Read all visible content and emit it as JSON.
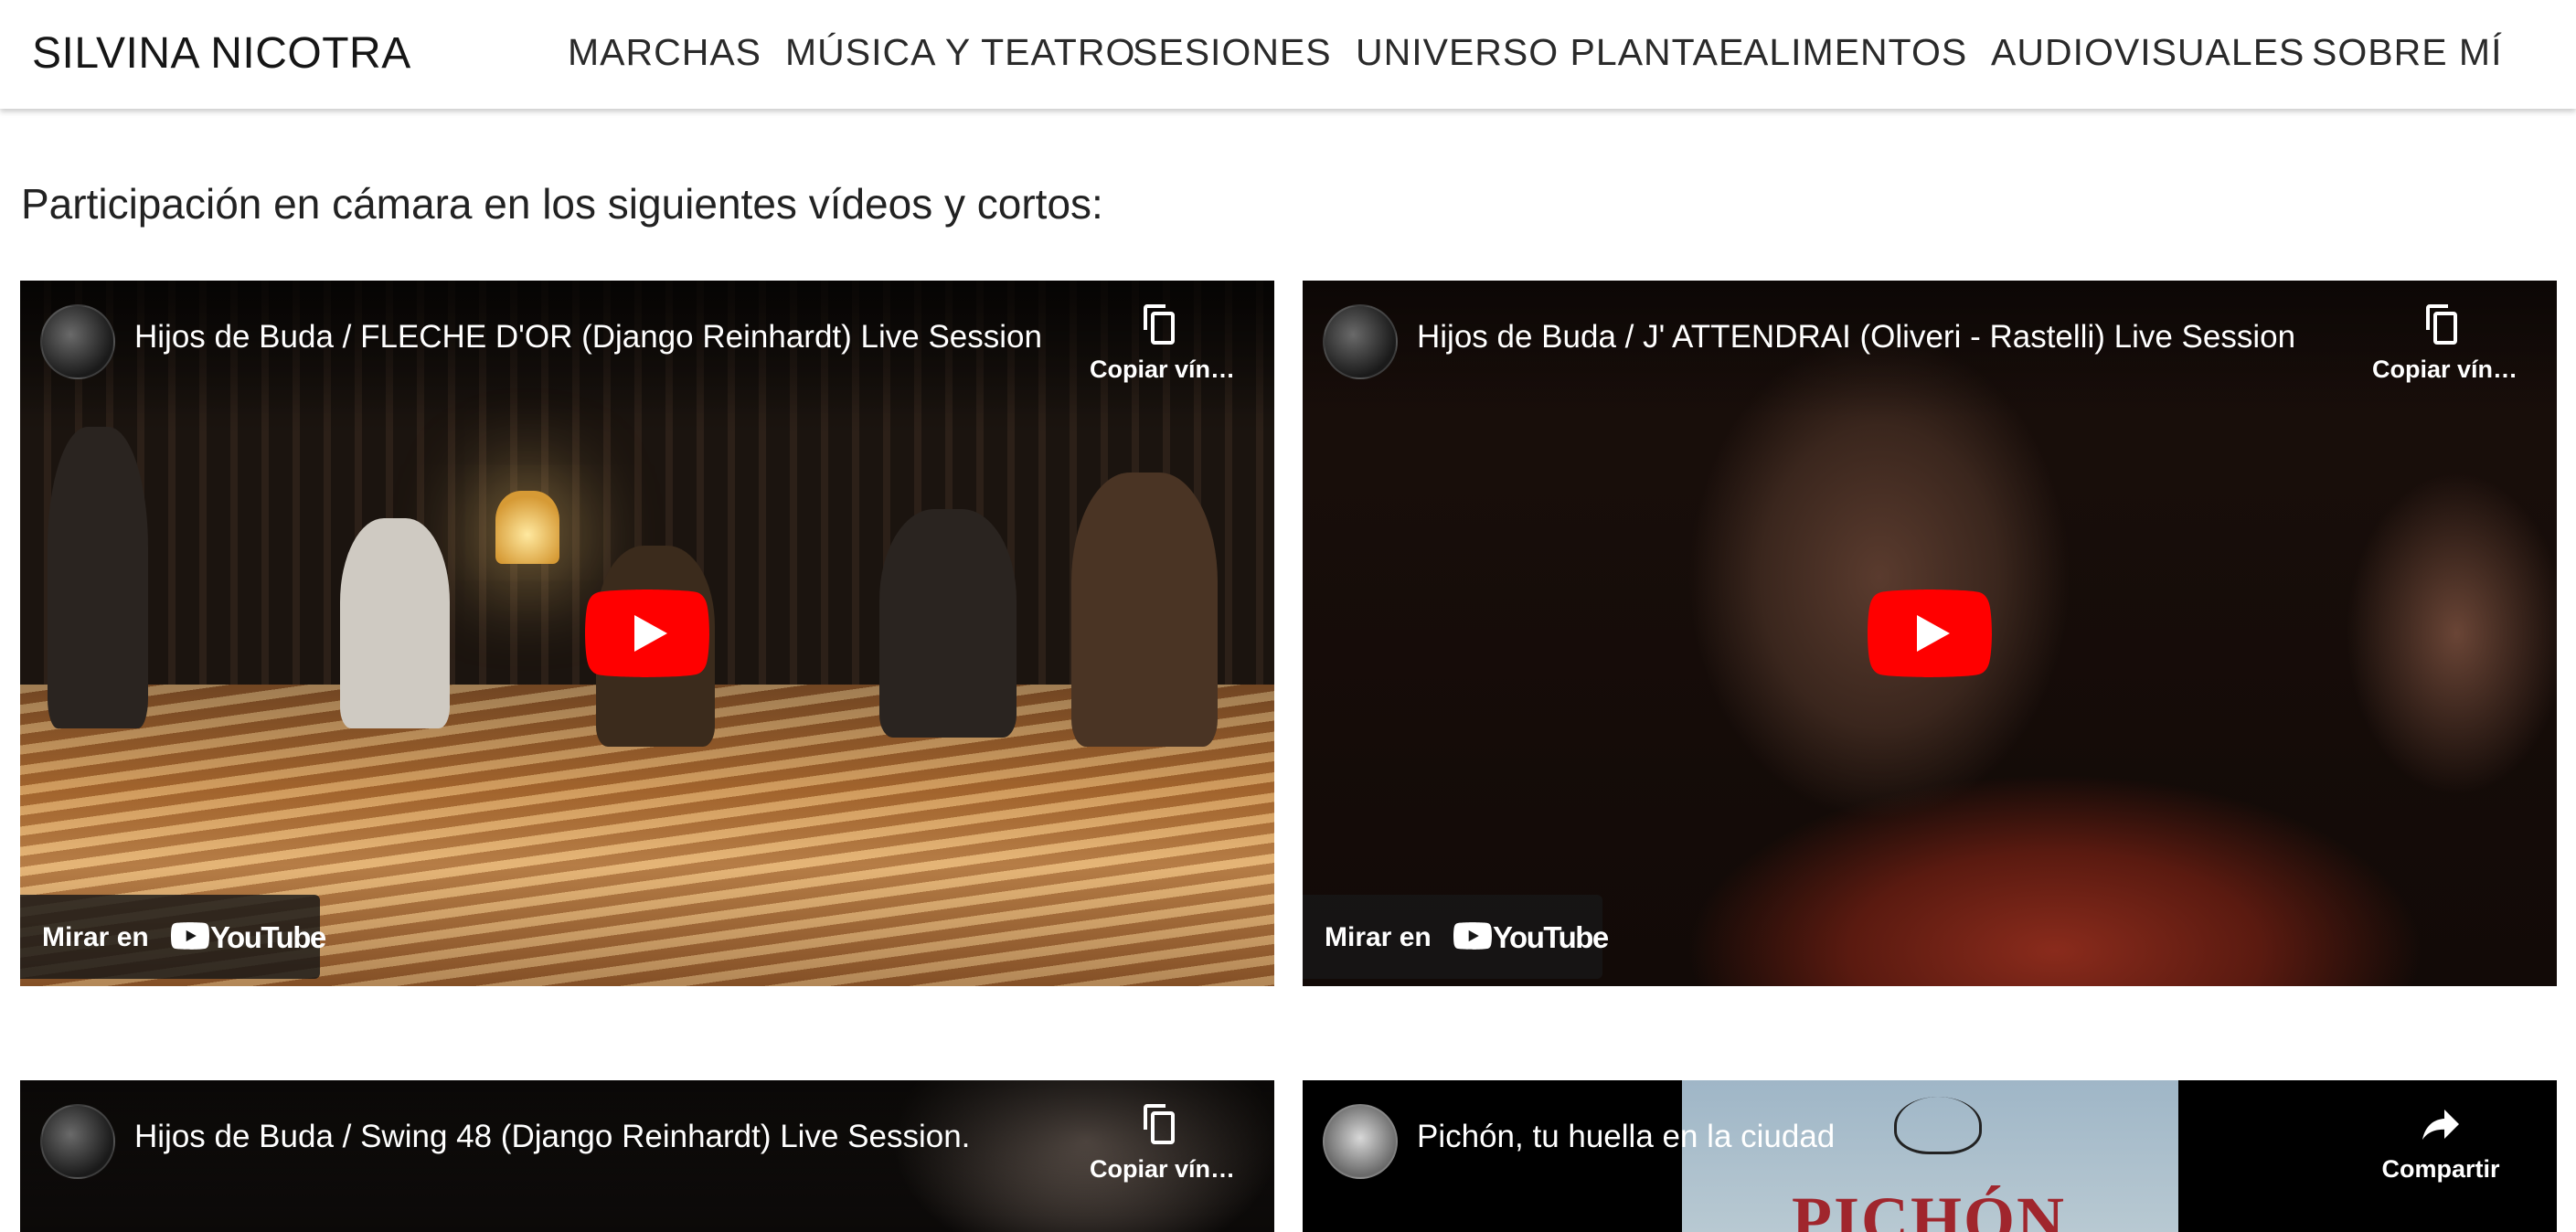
{
  "header": {
    "brand": "SILVINA NICOTRA",
    "nav": [
      "MARCHAS",
      "MÚSICA Y TEATRO",
      "SESIONES",
      "UNIVERSO PLANTAE",
      "ALIMENTOS",
      "AUDIOVISUALES",
      "SOBRE MÍ"
    ]
  },
  "intro": "Participación en cámara en los siguientes vídeos y cortos:",
  "videos": [
    {
      "title": "Hijos de Buda / FLECHE D'OR (Django Reinhardt) Live Session",
      "action_label": "Copiar vín…",
      "action_icon": "copy-icon",
      "watch_label": "Mirar en",
      "watch_brand": "YouTube"
    },
    {
      "title": "Hijos de Buda / J' ATTENDRAI (Oliveri - Rastelli) Live Session",
      "action_label": "Copiar vín…",
      "action_icon": "copy-icon",
      "watch_label": "Mirar en",
      "watch_brand": "YouTube"
    },
    {
      "title": "Hijos de Buda / Swing 48 (Django Reinhardt) Live Session.",
      "action_label": "Copiar vín…",
      "action_icon": "copy-icon"
    },
    {
      "title": "Pichón, tu huella en la ciudad",
      "action_label": "Compartir",
      "action_icon": "share-icon",
      "poster_text": "PICHÓN"
    }
  ],
  "colors": {
    "play_red": "#ff0000",
    "header_bg": "#ffffff",
    "text": "#1e1e1e"
  }
}
